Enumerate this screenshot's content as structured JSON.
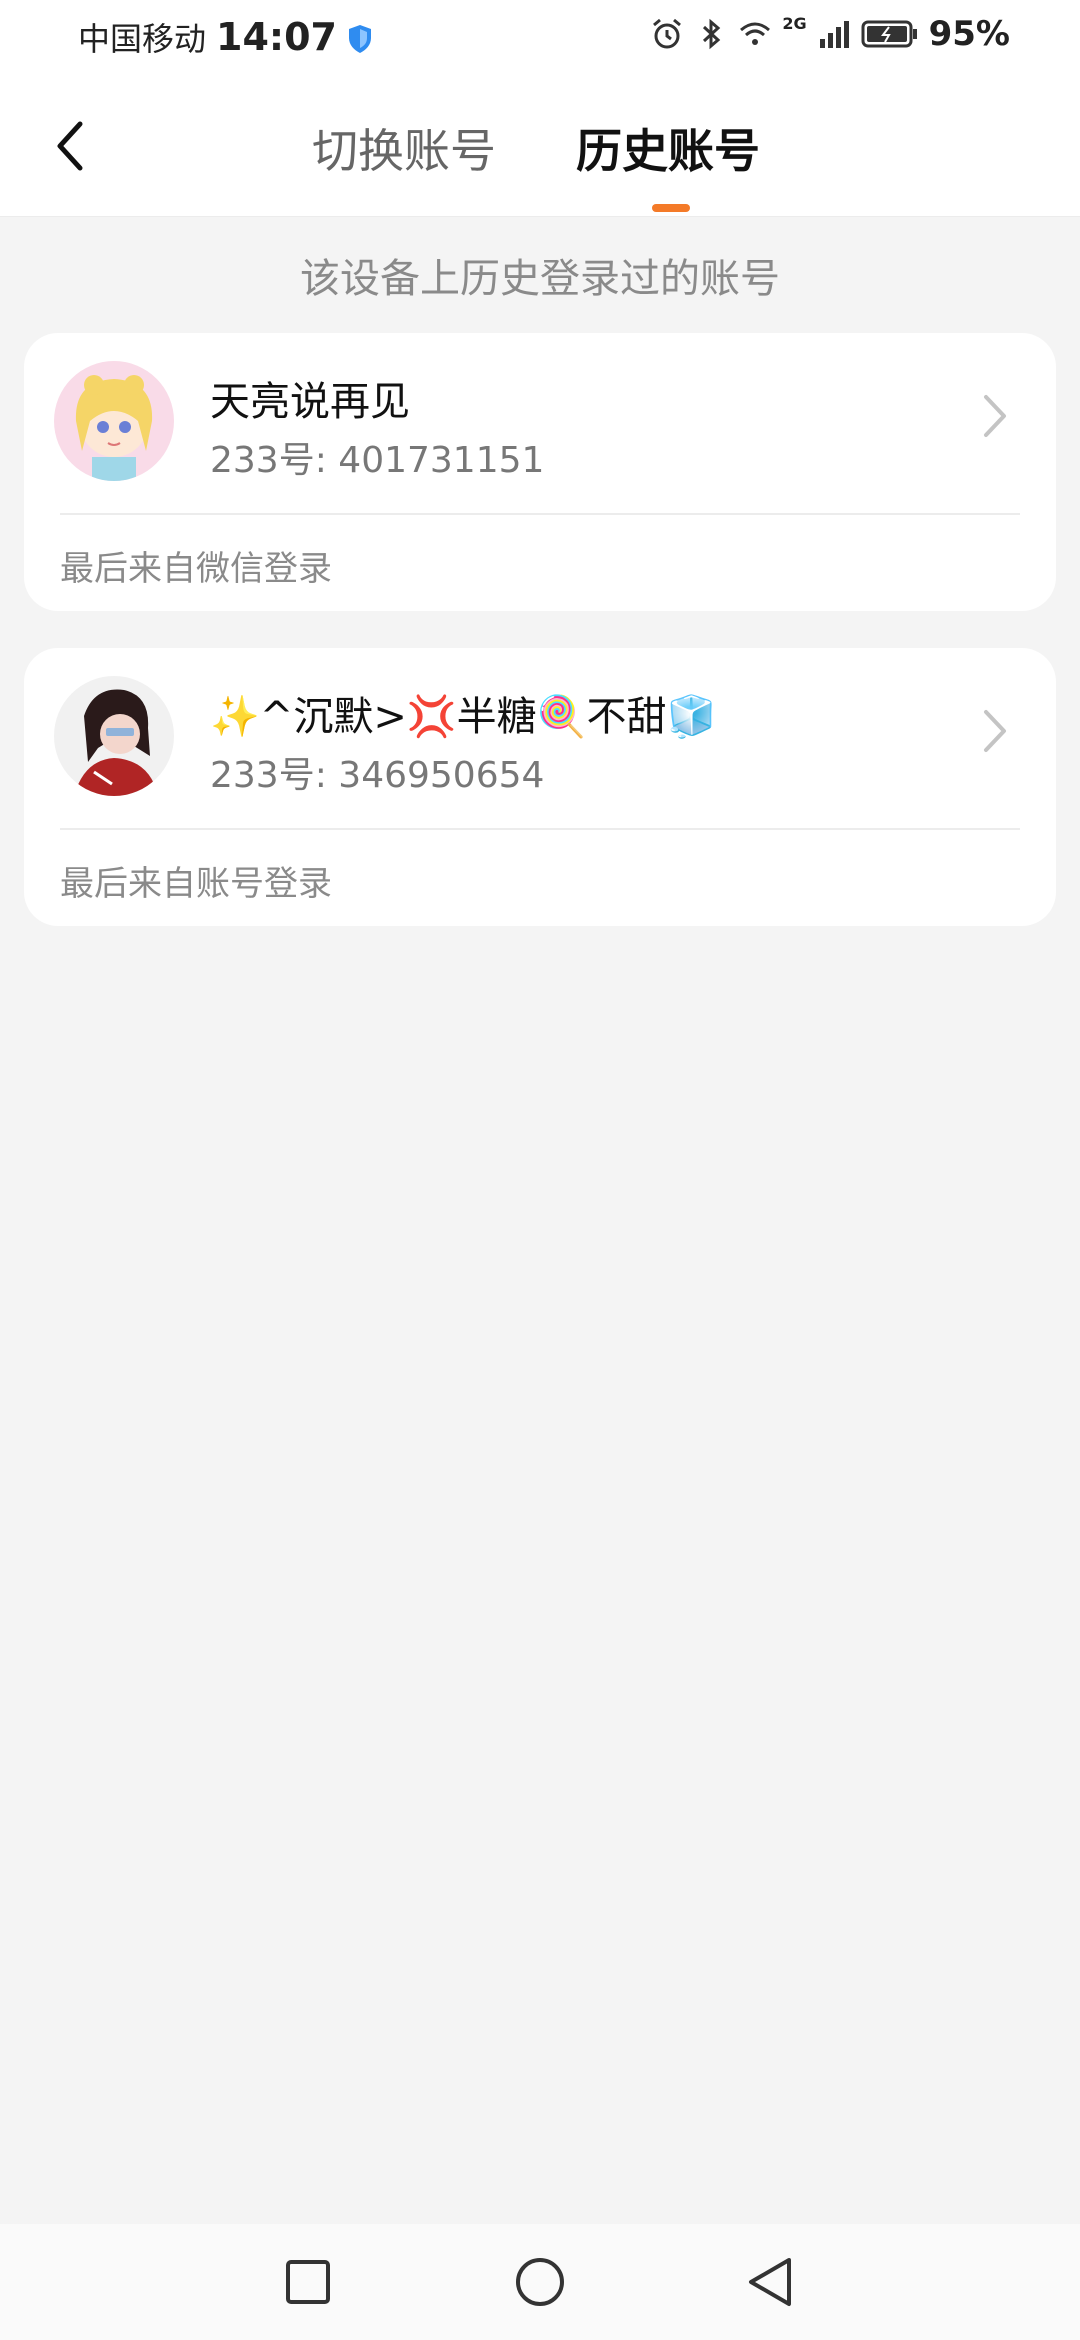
{
  "status_bar": {
    "carrier": "中国移动",
    "time": "14:07",
    "network": "2G",
    "battery": "95%"
  },
  "header": {
    "tabs": [
      {
        "label": "切换账号",
        "active": false
      },
      {
        "label": "历史账号",
        "active": true
      }
    ],
    "accent_color": "#f47a28"
  },
  "main": {
    "subtitle": "该设备上历史登录过的账号",
    "accounts": [
      {
        "name": "天亮说再见",
        "id_text": "233号: 401731151",
        "last_login": "最后来自微信登录"
      },
      {
        "name": "✨^沉默>💢半糖🍭不甜🧊",
        "id_text": "233号: 346950654",
        "last_login": "最后来自账号登录"
      }
    ]
  },
  "navigation": {
    "buttons": [
      "recent-apps-icon",
      "home-icon",
      "back-triangle-icon"
    ]
  }
}
